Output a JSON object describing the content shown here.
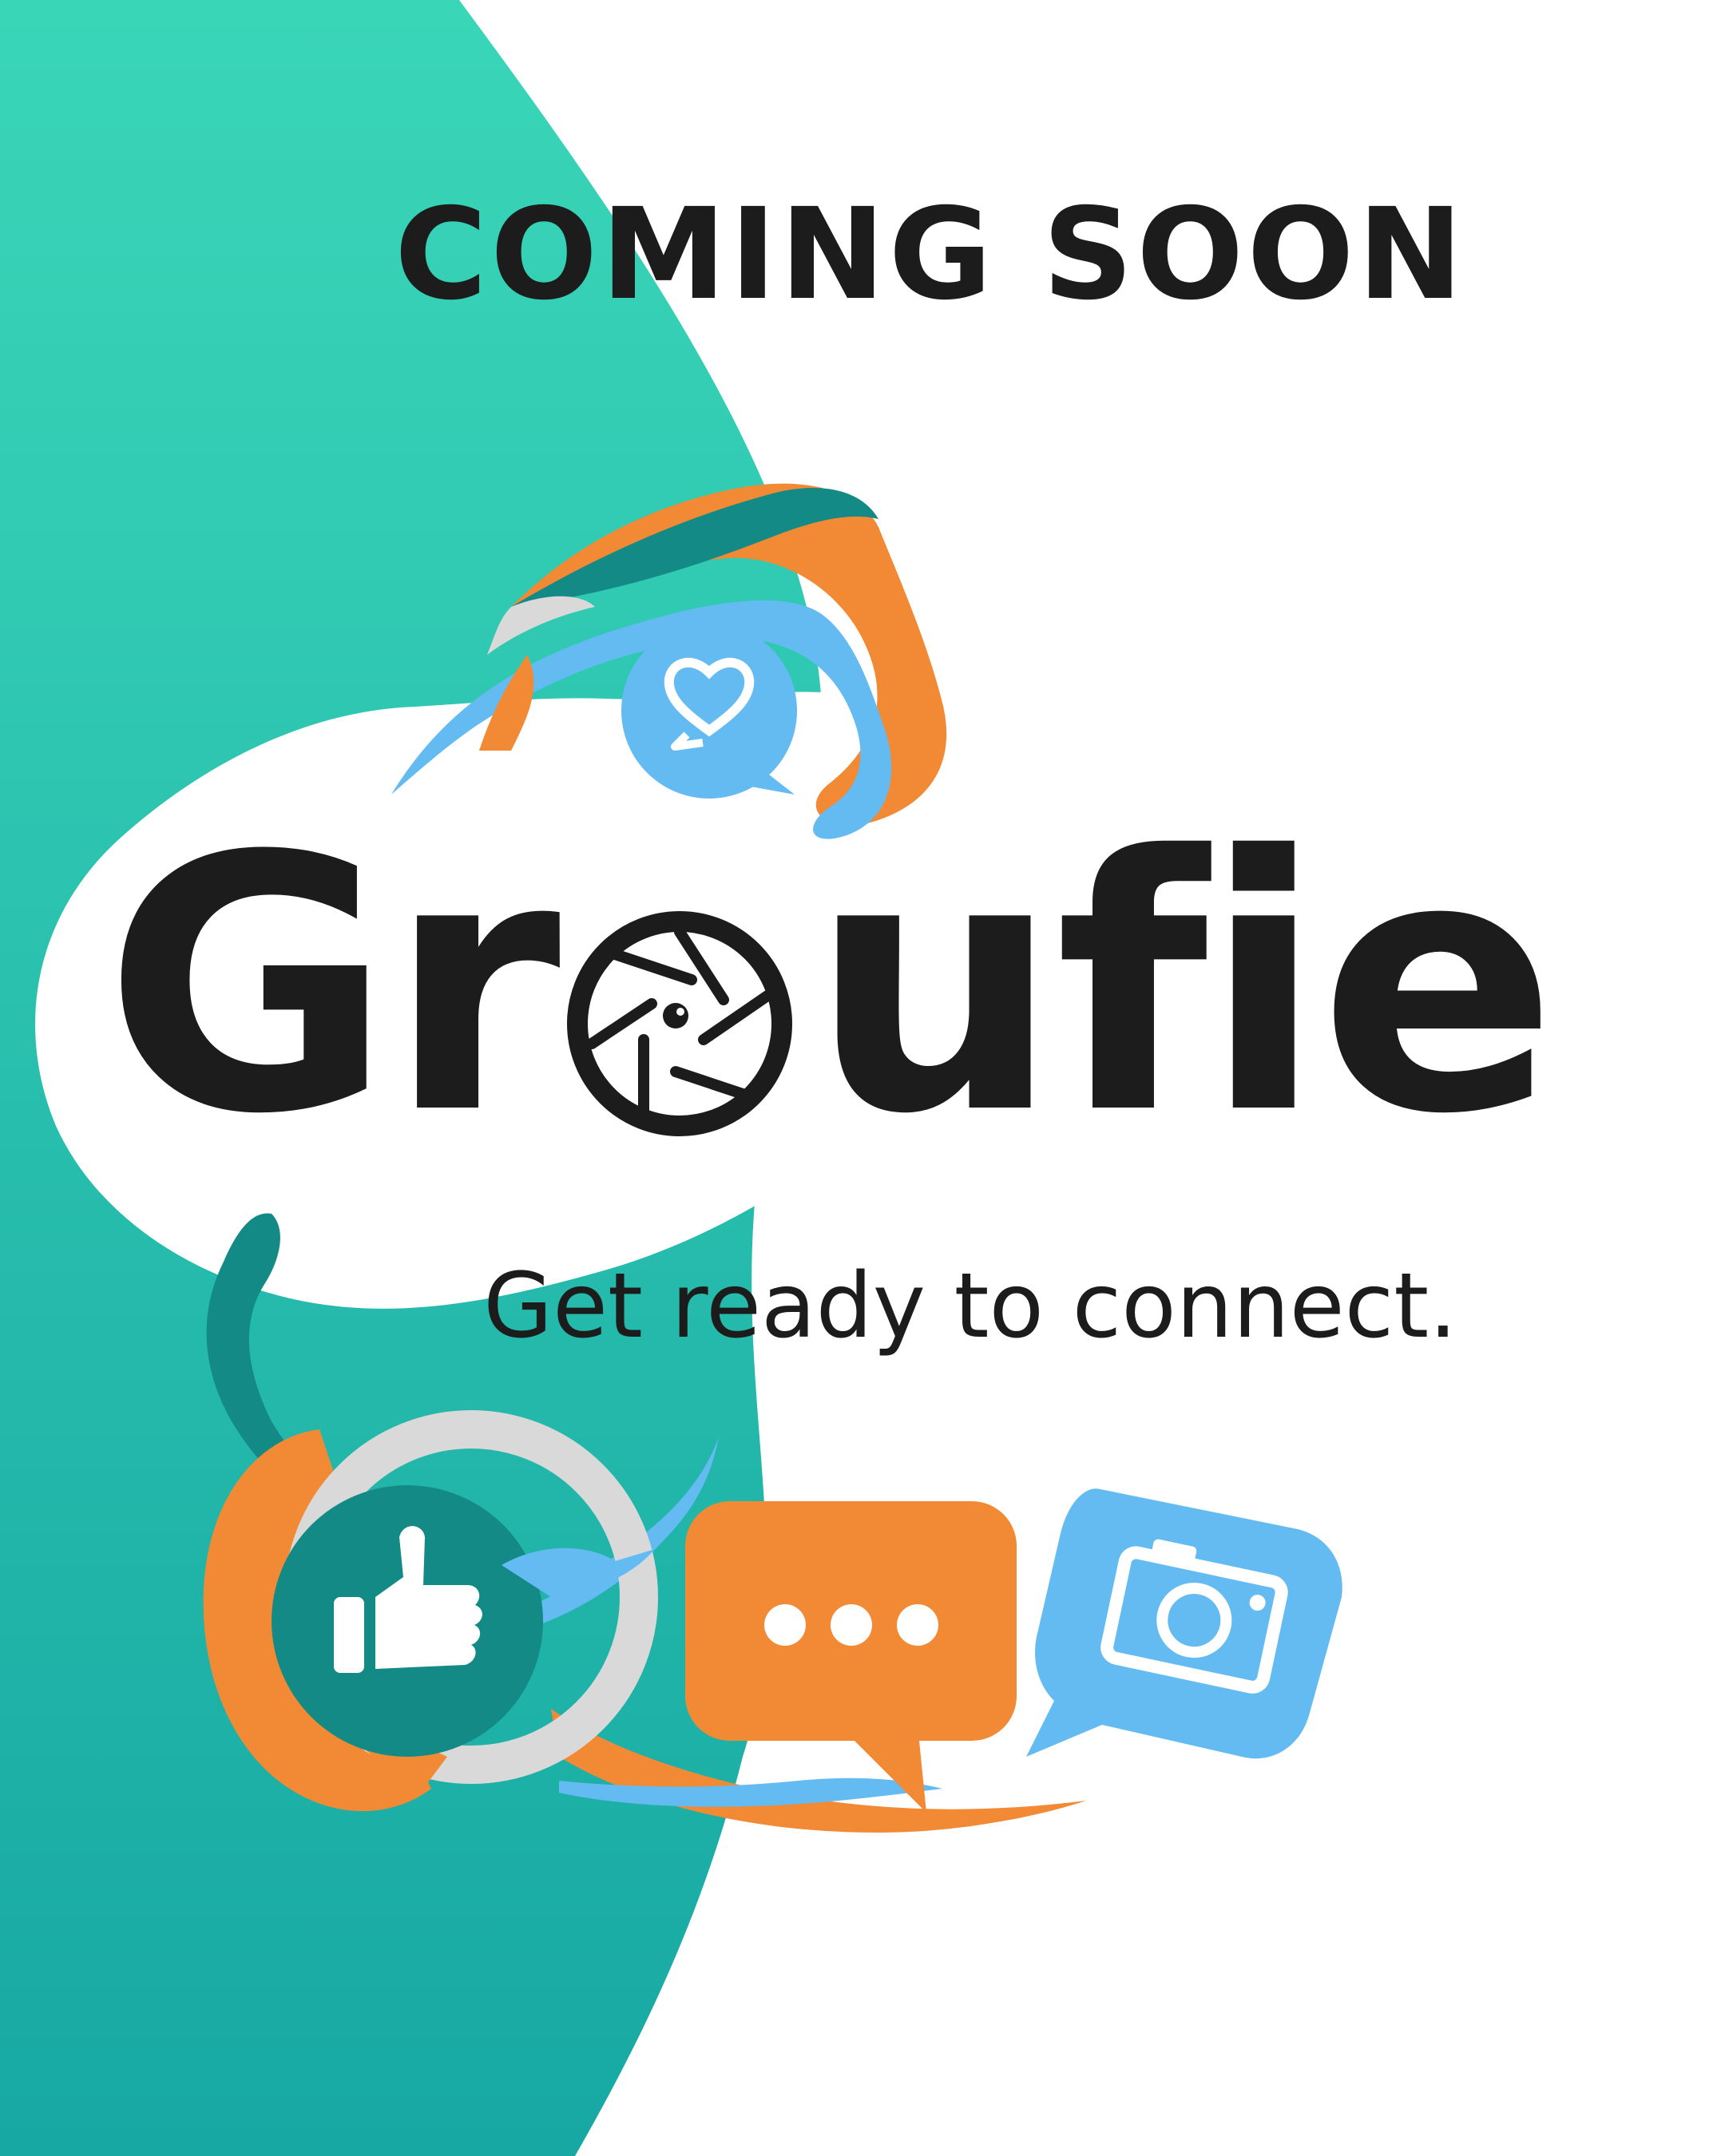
{
  "poster": {
    "heading": "COMING SOON",
    "wordmark": {
      "before_lens": "Gr",
      "after_lens": "ufie",
      "lens_icon": "camera-aperture-icon"
    },
    "tagline": "Get ready to connect."
  },
  "icons": [
    "heart-chat-bubble-icon",
    "thumbs-up-icon",
    "typing-chat-bubble-icon",
    "camera-chat-bubble-icon"
  ],
  "colors": {
    "teal_gradient_top": "#3ad6b8",
    "teal_gradient_bottom": "#17a8a3",
    "dark_teal": "#138a86",
    "orange": "#f28a35",
    "sky_blue": "#63bbf2",
    "light_gray": "#d9d9d9",
    "text_dark": "#1c1c1c",
    "white": "#ffffff"
  }
}
